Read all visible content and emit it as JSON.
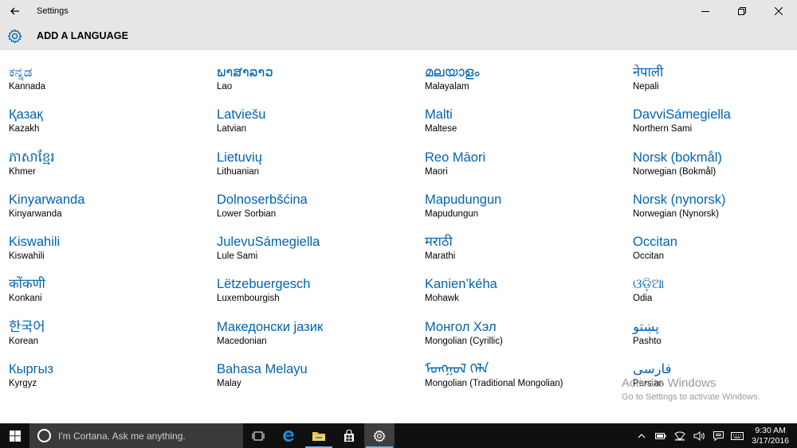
{
  "window": {
    "app_title": "Settings",
    "back_icon": "back-arrow-icon",
    "controls": [
      "minimize-icon",
      "restore-icon",
      "close-icon"
    ]
  },
  "header": {
    "icon": "gear-icon",
    "title": "ADD A LANGUAGE"
  },
  "columns": [
    [
      {
        "native": "ಕನ್ನಡ",
        "english": "Kannada"
      },
      {
        "native": "Қазақ",
        "english": "Kazakh"
      },
      {
        "native": "ភាសាខ្មែរ",
        "english": "Khmer"
      },
      {
        "native": "Kinyarwanda",
        "english": "Kinyarwanda"
      },
      {
        "native": "Kiswahili",
        "english": "Kiswahili"
      },
      {
        "native": "कोंकणी",
        "english": "Konkani"
      },
      {
        "native": "한국어",
        "english": "Korean"
      },
      {
        "native": "Кыргыз",
        "english": "Kyrgyz"
      }
    ],
    [
      {
        "native": "ພາສາລາວ",
        "english": "Lao"
      },
      {
        "native": "Latviešu",
        "english": "Latvian"
      },
      {
        "native": "Lietuvių",
        "english": "Lithuanian"
      },
      {
        "native": "Dolnoserbšćina",
        "english": "Lower Sorbian"
      },
      {
        "native": "JulevuSámegiella",
        "english": "Lule Sami"
      },
      {
        "native": "Lëtzebuergesch",
        "english": "Luxembourgish"
      },
      {
        "native": "Македонски јазик",
        "english": "Macedonian"
      },
      {
        "native": "Bahasa Melayu",
        "english": "Malay"
      }
    ],
    [
      {
        "native": "മലയാളം",
        "english": "Malayalam"
      },
      {
        "native": "Malti",
        "english": "Maltese"
      },
      {
        "native": "Reo Māori",
        "english": "Maori"
      },
      {
        "native": "Mapudungun",
        "english": "Mapudungun"
      },
      {
        "native": "मराठी",
        "english": "Marathi"
      },
      {
        "native": "Kanien’kéha",
        "english": "Mohawk"
      },
      {
        "native": "Монгол Хэл",
        "english": "Mongolian (Cyrillic)"
      },
      {
        "native": "ᠮᠣᠩᠭᠣᠯ ᠬᠡᠯᠡ",
        "english": "Mongolian (Traditional Mongolian)"
      }
    ],
    [
      {
        "native": "नेपाली",
        "english": "Nepali"
      },
      {
        "native": "DavviSámegiella",
        "english": "Northern Sami"
      },
      {
        "native": "Norsk (bokmål)",
        "english": "Norwegian (Bokmål)"
      },
      {
        "native": "Norsk (nynorsk)",
        "english": "Norwegian (Nynorsk)"
      },
      {
        "native": "Occitan",
        "english": "Occitan"
      },
      {
        "native": "ଓଡ଼ିଆ",
        "english": "Odia"
      },
      {
        "native": "پښتو",
        "english": "Pashto"
      },
      {
        "native": "فارسی",
        "english": "Persian"
      }
    ]
  ],
  "watermark": {
    "title": "Activate Windows",
    "subtitle": "Go to Settings to activate Windows."
  },
  "taskbar": {
    "cortana_placeholder": "I'm Cortana. Ask me anything.",
    "pinned_icons": [
      "task-view-icon",
      "edge-icon",
      "file-explorer-icon",
      "store-icon",
      "settings-icon"
    ],
    "tray_icons": [
      "chevron-up-icon",
      "battery-icon",
      "wifi-icon",
      "volume-icon",
      "action-center-icon",
      "keyboard-icon"
    ],
    "time": "9:30 AM",
    "date": "3/17/2016"
  },
  "colors": {
    "accent": "#0063b1",
    "chrome": "#e6e6e6",
    "taskbar": "#101010"
  }
}
